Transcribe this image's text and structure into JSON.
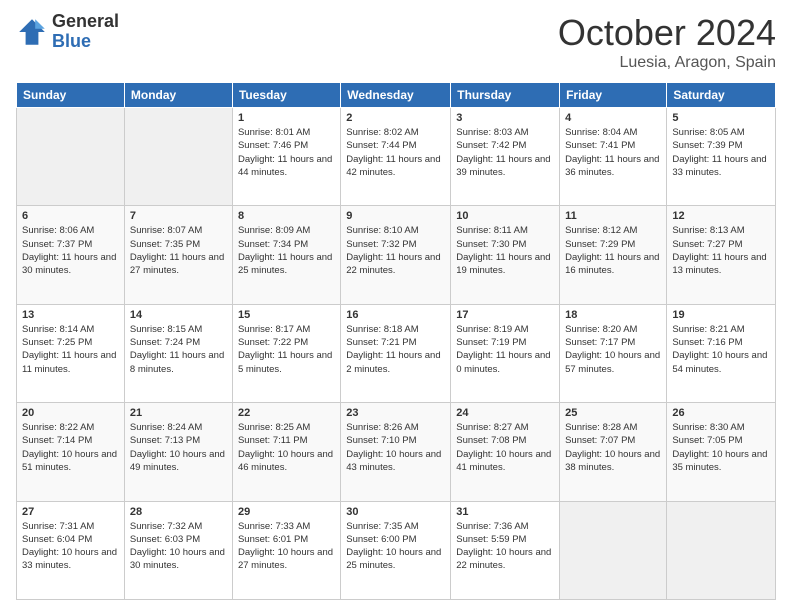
{
  "header": {
    "logo_general": "General",
    "logo_blue": "Blue",
    "month": "October 2024",
    "location": "Luesia, Aragon, Spain"
  },
  "days_of_week": [
    "Sunday",
    "Monday",
    "Tuesday",
    "Wednesday",
    "Thursday",
    "Friday",
    "Saturday"
  ],
  "weeks": [
    [
      {
        "day": "",
        "sunrise": "",
        "sunset": "",
        "daylight": ""
      },
      {
        "day": "",
        "sunrise": "",
        "sunset": "",
        "daylight": ""
      },
      {
        "day": "1",
        "sunrise": "Sunrise: 8:01 AM",
        "sunset": "Sunset: 7:46 PM",
        "daylight": "Daylight: 11 hours and 44 minutes."
      },
      {
        "day": "2",
        "sunrise": "Sunrise: 8:02 AM",
        "sunset": "Sunset: 7:44 PM",
        "daylight": "Daylight: 11 hours and 42 minutes."
      },
      {
        "day": "3",
        "sunrise": "Sunrise: 8:03 AM",
        "sunset": "Sunset: 7:42 PM",
        "daylight": "Daylight: 11 hours and 39 minutes."
      },
      {
        "day": "4",
        "sunrise": "Sunrise: 8:04 AM",
        "sunset": "Sunset: 7:41 PM",
        "daylight": "Daylight: 11 hours and 36 minutes."
      },
      {
        "day": "5",
        "sunrise": "Sunrise: 8:05 AM",
        "sunset": "Sunset: 7:39 PM",
        "daylight": "Daylight: 11 hours and 33 minutes."
      }
    ],
    [
      {
        "day": "6",
        "sunrise": "Sunrise: 8:06 AM",
        "sunset": "Sunset: 7:37 PM",
        "daylight": "Daylight: 11 hours and 30 minutes."
      },
      {
        "day": "7",
        "sunrise": "Sunrise: 8:07 AM",
        "sunset": "Sunset: 7:35 PM",
        "daylight": "Daylight: 11 hours and 27 minutes."
      },
      {
        "day": "8",
        "sunrise": "Sunrise: 8:09 AM",
        "sunset": "Sunset: 7:34 PM",
        "daylight": "Daylight: 11 hours and 25 minutes."
      },
      {
        "day": "9",
        "sunrise": "Sunrise: 8:10 AM",
        "sunset": "Sunset: 7:32 PM",
        "daylight": "Daylight: 11 hours and 22 minutes."
      },
      {
        "day": "10",
        "sunrise": "Sunrise: 8:11 AM",
        "sunset": "Sunset: 7:30 PM",
        "daylight": "Daylight: 11 hours and 19 minutes."
      },
      {
        "day": "11",
        "sunrise": "Sunrise: 8:12 AM",
        "sunset": "Sunset: 7:29 PM",
        "daylight": "Daylight: 11 hours and 16 minutes."
      },
      {
        "day": "12",
        "sunrise": "Sunrise: 8:13 AM",
        "sunset": "Sunset: 7:27 PM",
        "daylight": "Daylight: 11 hours and 13 minutes."
      }
    ],
    [
      {
        "day": "13",
        "sunrise": "Sunrise: 8:14 AM",
        "sunset": "Sunset: 7:25 PM",
        "daylight": "Daylight: 11 hours and 11 minutes."
      },
      {
        "day": "14",
        "sunrise": "Sunrise: 8:15 AM",
        "sunset": "Sunset: 7:24 PM",
        "daylight": "Daylight: 11 hours and 8 minutes."
      },
      {
        "day": "15",
        "sunrise": "Sunrise: 8:17 AM",
        "sunset": "Sunset: 7:22 PM",
        "daylight": "Daylight: 11 hours and 5 minutes."
      },
      {
        "day": "16",
        "sunrise": "Sunrise: 8:18 AM",
        "sunset": "Sunset: 7:21 PM",
        "daylight": "Daylight: 11 hours and 2 minutes."
      },
      {
        "day": "17",
        "sunrise": "Sunrise: 8:19 AM",
        "sunset": "Sunset: 7:19 PM",
        "daylight": "Daylight: 11 hours and 0 minutes."
      },
      {
        "day": "18",
        "sunrise": "Sunrise: 8:20 AM",
        "sunset": "Sunset: 7:17 PM",
        "daylight": "Daylight: 10 hours and 57 minutes."
      },
      {
        "day": "19",
        "sunrise": "Sunrise: 8:21 AM",
        "sunset": "Sunset: 7:16 PM",
        "daylight": "Daylight: 10 hours and 54 minutes."
      }
    ],
    [
      {
        "day": "20",
        "sunrise": "Sunrise: 8:22 AM",
        "sunset": "Sunset: 7:14 PM",
        "daylight": "Daylight: 10 hours and 51 minutes."
      },
      {
        "day": "21",
        "sunrise": "Sunrise: 8:24 AM",
        "sunset": "Sunset: 7:13 PM",
        "daylight": "Daylight: 10 hours and 49 minutes."
      },
      {
        "day": "22",
        "sunrise": "Sunrise: 8:25 AM",
        "sunset": "Sunset: 7:11 PM",
        "daylight": "Daylight: 10 hours and 46 minutes."
      },
      {
        "day": "23",
        "sunrise": "Sunrise: 8:26 AM",
        "sunset": "Sunset: 7:10 PM",
        "daylight": "Daylight: 10 hours and 43 minutes."
      },
      {
        "day": "24",
        "sunrise": "Sunrise: 8:27 AM",
        "sunset": "Sunset: 7:08 PM",
        "daylight": "Daylight: 10 hours and 41 minutes."
      },
      {
        "day": "25",
        "sunrise": "Sunrise: 8:28 AM",
        "sunset": "Sunset: 7:07 PM",
        "daylight": "Daylight: 10 hours and 38 minutes."
      },
      {
        "day": "26",
        "sunrise": "Sunrise: 8:30 AM",
        "sunset": "Sunset: 7:05 PM",
        "daylight": "Daylight: 10 hours and 35 minutes."
      }
    ],
    [
      {
        "day": "27",
        "sunrise": "Sunrise: 7:31 AM",
        "sunset": "Sunset: 6:04 PM",
        "daylight": "Daylight: 10 hours and 33 minutes."
      },
      {
        "day": "28",
        "sunrise": "Sunrise: 7:32 AM",
        "sunset": "Sunset: 6:03 PM",
        "daylight": "Daylight: 10 hours and 30 minutes."
      },
      {
        "day": "29",
        "sunrise": "Sunrise: 7:33 AM",
        "sunset": "Sunset: 6:01 PM",
        "daylight": "Daylight: 10 hours and 27 minutes."
      },
      {
        "day": "30",
        "sunrise": "Sunrise: 7:35 AM",
        "sunset": "Sunset: 6:00 PM",
        "daylight": "Daylight: 10 hours and 25 minutes."
      },
      {
        "day": "31",
        "sunrise": "Sunrise: 7:36 AM",
        "sunset": "Sunset: 5:59 PM",
        "daylight": "Daylight: 10 hours and 22 minutes."
      },
      {
        "day": "",
        "sunrise": "",
        "sunset": "",
        "daylight": ""
      },
      {
        "day": "",
        "sunrise": "",
        "sunset": "",
        "daylight": ""
      }
    ]
  ]
}
